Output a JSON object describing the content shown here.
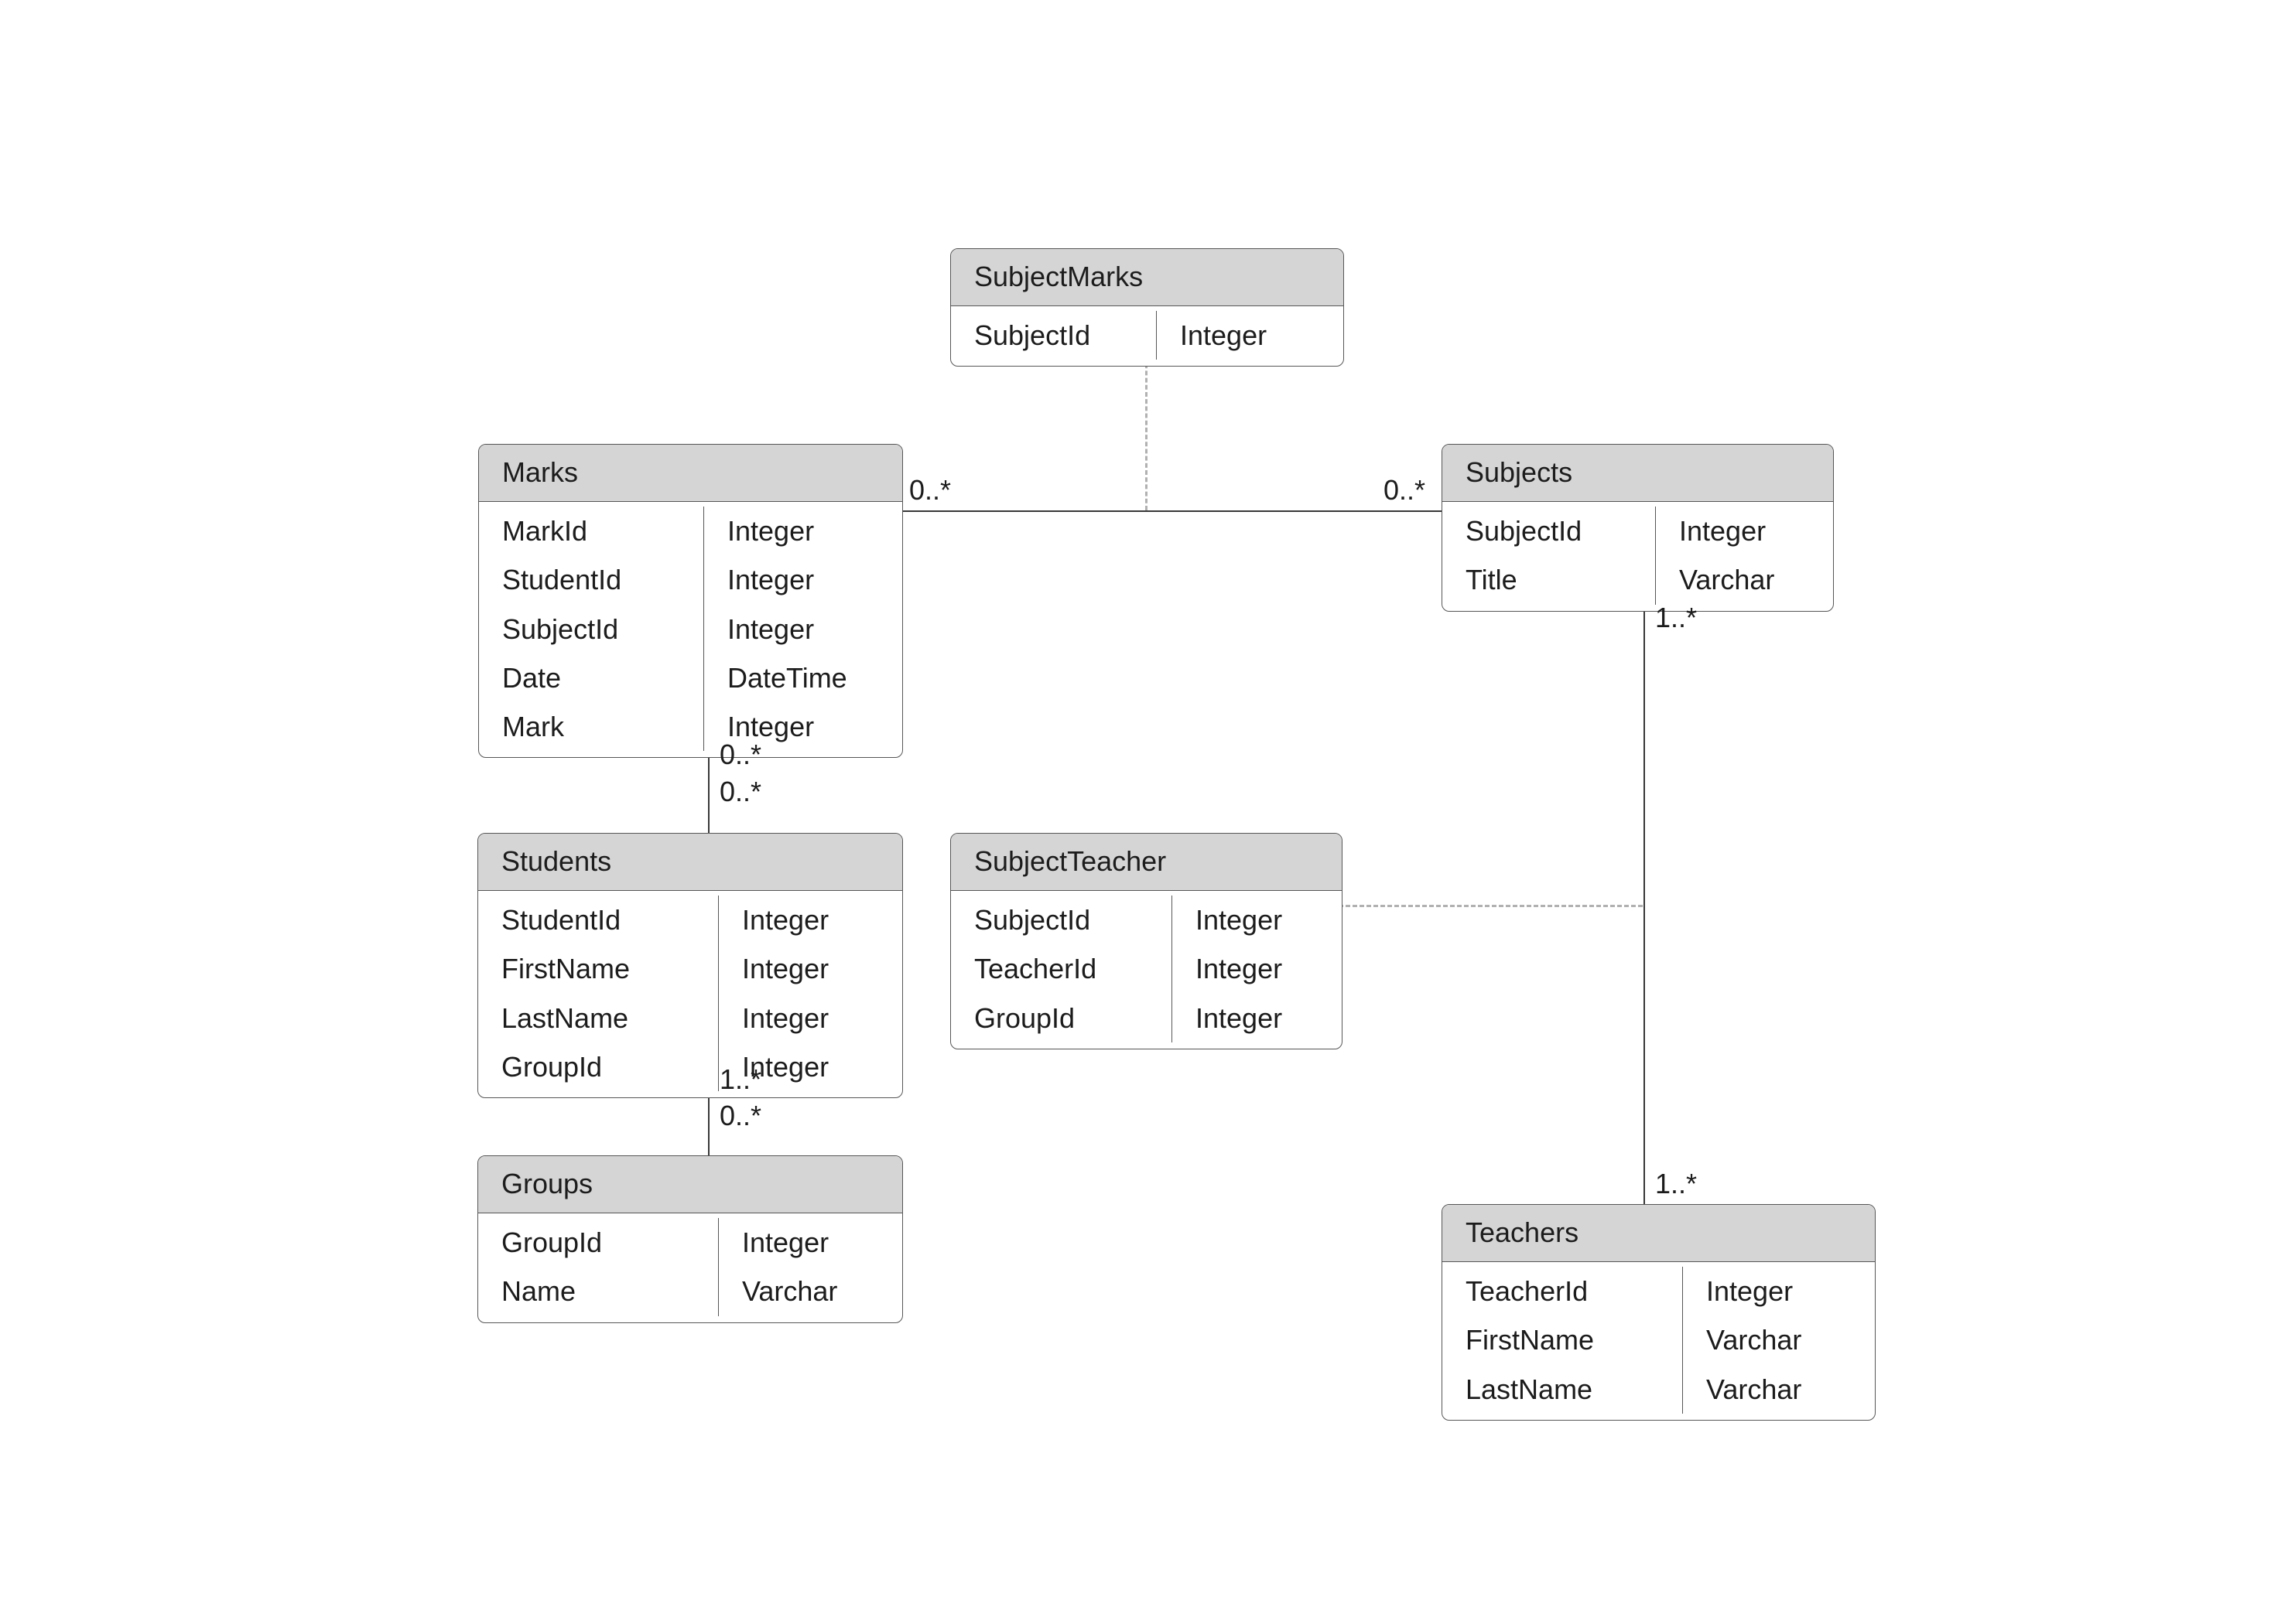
{
  "entities": {
    "subjectMarks": {
      "title": "SubjectMarks",
      "rows": [
        {
          "name": "SubjectId",
          "type": "Integer"
        }
      ]
    },
    "marks": {
      "title": "Marks",
      "rows": [
        {
          "name": "MarkId",
          "type": "Integer"
        },
        {
          "name": "StudentId",
          "type": "Integer"
        },
        {
          "name": "SubjectId",
          "type": "Integer"
        },
        {
          "name": "Date",
          "type": "DateTime"
        },
        {
          "name": "Mark",
          "type": "Integer"
        }
      ]
    },
    "subjects": {
      "title": "Subjects",
      "rows": [
        {
          "name": "SubjectId",
          "type": "Integer"
        },
        {
          "name": "Title",
          "type": "Varchar"
        }
      ]
    },
    "students": {
      "title": "Students",
      "rows": [
        {
          "name": "StudentId",
          "type": "Integer"
        },
        {
          "name": "FirstName",
          "type": "Integer"
        },
        {
          "name": "LastName",
          "type": "Integer"
        },
        {
          "name": "GroupId",
          "type": "Integer"
        }
      ]
    },
    "subjectTeacher": {
      "title": "SubjectTeacher",
      "rows": [
        {
          "name": "SubjectId",
          "type": "Integer"
        },
        {
          "name": "TeacherId",
          "type": "Integer"
        },
        {
          "name": "GroupId",
          "type": "Integer"
        }
      ]
    },
    "groups": {
      "title": "Groups",
      "rows": [
        {
          "name": "GroupId",
          "type": "Integer"
        },
        {
          "name": "Name",
          "type": "Varchar"
        }
      ]
    },
    "teachers": {
      "title": "Teachers",
      "rows": [
        {
          "name": "TeacherId",
          "type": "Integer"
        },
        {
          "name": "FirstName",
          "type": "Varchar"
        },
        {
          "name": "LastName",
          "type": "Varchar"
        }
      ]
    }
  },
  "mult": {
    "marksSubjects_left": "0..*",
    "marksSubjects_right": "0..*",
    "subjectsTeachers_top": "1..*",
    "subjectsTeachers_bottom": "1..*",
    "marksStudents_top": "0..*",
    "marksStudents_bottom": "0..*",
    "studentsGroups_top": "1..*",
    "studentsGroups_bottom": "0..*"
  }
}
